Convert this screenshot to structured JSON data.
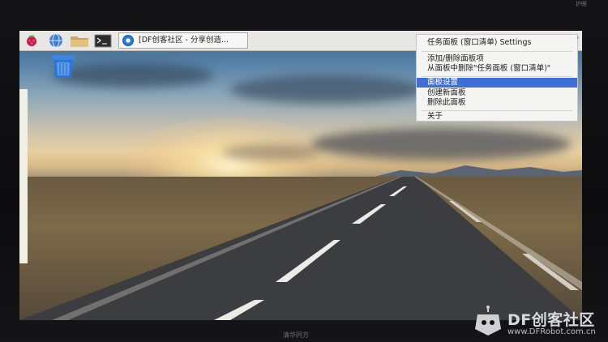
{
  "monitor": {
    "top_label": "护眼",
    "bottom_brand": "清华同方"
  },
  "panel": {
    "launchers": [
      {
        "icon": "raspberry-menu-icon"
      },
      {
        "icon": "web-browser-icon"
      },
      {
        "icon": "file-manager-icon"
      },
      {
        "icon": "terminal-icon"
      }
    ],
    "task_button": {
      "icon": "chromium-icon",
      "label": "[DF创客社区 - 分享创造..."
    }
  },
  "desktop": {
    "trash_icon": "trash-icon"
  },
  "context_menu": {
    "title": "任务面板 (窗口清单) Settings",
    "items": [
      {
        "label": "添加/删除面板项",
        "selected": false
      },
      {
        "label": "从面板中删除\"任务面板 (窗口清单)\"",
        "selected": false
      },
      {
        "label": "面板设置",
        "selected": true
      },
      {
        "label": "创建新面板",
        "selected": false
      },
      {
        "label": "删除此面板",
        "selected": false
      },
      {
        "label": "关于",
        "selected": false
      }
    ],
    "chevron": "›"
  },
  "watermark": {
    "title": "DF创客社区",
    "url": "www.DFRobot.com.cn"
  },
  "colors": {
    "menu_selected": "#3d6fd4",
    "panel_bg": "#e8e7e3"
  }
}
